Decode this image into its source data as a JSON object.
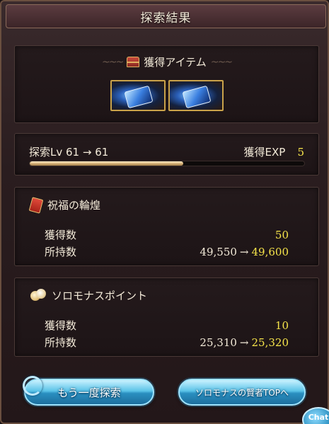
{
  "window": {
    "title": "探索結果"
  },
  "items_panel": {
    "header": "獲得アイテム",
    "item_count": 2
  },
  "level": {
    "text": "探索Lv 61 → 61",
    "exp_label": "獲得EXP",
    "exp_value": "5",
    "progress_fraction": 0.56
  },
  "reward1": {
    "name": "祝福の輪煌",
    "gain_label": "獲得数",
    "gain_value": "50",
    "owned_label": "所持数",
    "owned_old": "49,550",
    "arrow": "→",
    "owned_new": "49,600"
  },
  "reward2": {
    "name": "ソロモナスポイント",
    "gain_label": "獲得数",
    "gain_value": "10",
    "owned_label": "所持数",
    "owned_old": "25,310",
    "arrow": "→",
    "owned_new": "25,320"
  },
  "buttons": {
    "retry": "もう一度探索",
    "top": "ソロモナスの賢者TOPへ"
  },
  "chat": {
    "label": "Chat"
  },
  "colors": {
    "highlight": "#f6e44a",
    "button": "#5bc3e8",
    "frame": "#3a2a2c"
  },
  "icons": [
    "chest-icon",
    "ticket-icon",
    "coin-icon",
    "retry-icon",
    "chat-icon"
  ]
}
